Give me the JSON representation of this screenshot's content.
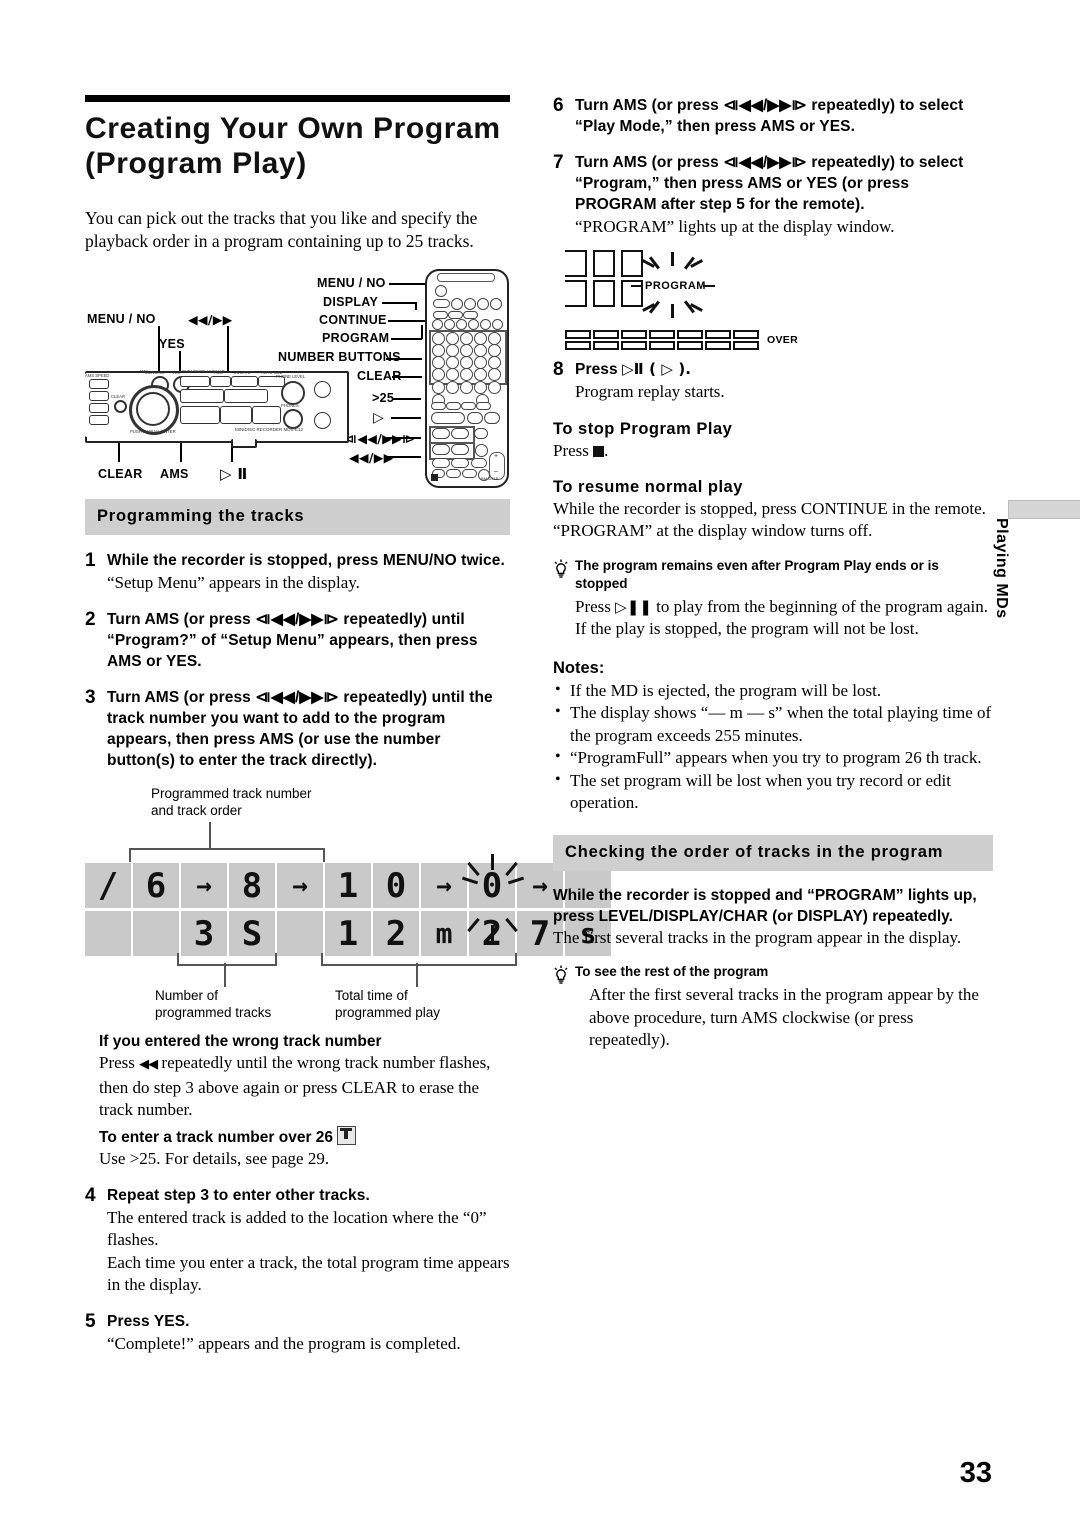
{
  "page": {
    "number": "33",
    "side_tab": "Playing MDs"
  },
  "left": {
    "title": "Creating Your Own Program (Program Play)",
    "title_line1": "Creating Your Own Program",
    "title_line2": "(Program Play)",
    "intro": "You can pick out the tracks that you like and specify the playback order in a program containing up to 25 tracks.",
    "section_heading": "Programming the tracks",
    "steps": [
      {
        "num": "1",
        "lead": "While the recorder is stopped, press MENU/NO twice.",
        "sub": "“Setup Menu” appears in the display."
      },
      {
        "num": "2",
        "lead": "Turn AMS (or press ⧏◀◀/▶▶⧐ repeatedly) until “Program?” of “Setup Menu” appears, then press AMS or YES.",
        "sub": ""
      },
      {
        "num": "3",
        "lead": "Turn AMS (or press ⧏◀◀/▶▶⧐ repeatedly) until the track number you want to add to the program appears, then press AMS (or use the number button(s) to enter the track directly).",
        "sub": ""
      }
    ],
    "wrong_track": {
      "heading": "If you entered the wrong track number",
      "body_pre": "Press ",
      "body_post": " repeatedly until the wrong track number flashes, then do step 3 above again or press CLEAR to erase the track number."
    },
    "over26": {
      "heading": "To enter a track number over 26",
      "body": "Use >25.  For details, see page 29."
    },
    "steps2": [
      {
        "num": "4",
        "lead": "Repeat step 3 to enter other tracks.",
        "sub1": "The entered track is added to the location where the “0” flashes.",
        "sub2": "Each time you enter a track, the total program time appears in the display."
      },
      {
        "num": "5",
        "lead": "Press YES.",
        "sub1": "“Complete!” appears and the program is completed."
      }
    ],
    "lcd": {
      "callout_top": "Programmed track number\nand track order",
      "callout_top_line1": "Programmed track number",
      "callout_top_line2": "and track order",
      "callout_left_line1": "Number of",
      "callout_left_line2": "programmed tracks",
      "callout_right_line1": "Total time of",
      "callout_right_line2": "programmed play",
      "row_top": [
        "/",
        "6",
        "→",
        "8",
        "→",
        "1",
        "0",
        "→",
        "0",
        "→",
        ""
      ],
      "row_bottom": [
        "",
        "",
        "3",
        "S",
        "",
        "1",
        "2",
        "m",
        "2",
        "7",
        "s"
      ]
    },
    "equipment_labels": {
      "deck_menu_no": "MENU / NO",
      "deck_ff_rew": "◀◀/▶▶",
      "deck_yes": "YES",
      "deck_clear": "CLEAR",
      "deck_ams": "AMS",
      "deck_play_pause": "▷ Ⅱ",
      "remote_menu_no": "MENU / NO",
      "remote_display": "DISPLAY",
      "remote_continue": "CONTINUE",
      "remote_program": "PROGRAM",
      "remote_number_buttons": "NUMBER BUTTONS",
      "remote_clear": "CLEAR",
      "remote_over25": ">25",
      "remote_play": "▷",
      "remote_skip": "⧏◀◀/▶▶⧐",
      "remote_scan": "◀◀/▶▶",
      "deck_model": "MINIDISC RECORDER MDS-E12",
      "deck_small_labels": [
        "MENU/NO",
        "AMS",
        "PUSH ENTER",
        "YES",
        "LEVEL / DISPLAY/CHAR",
        "TIME",
        "LOCATE",
        "AUTO CUE",
        "PHONE LEVEL",
        "PHONES",
        "MIN",
        "MAX",
        "CLEAR",
        "PUSH MANUAL/ENTER",
        "AMS SPEED"
      ]
    }
  },
  "right": {
    "steps": [
      {
        "num": "6",
        "lead": "Turn AMS (or press ⧏◀◀/▶▶⧐ repeatedly) to select “Play Mode,” then press AMS or YES.",
        "sub": ""
      },
      {
        "num": "7",
        "lead": "Turn AMS (or press ⧏◀◀/▶▶⧐ repeatedly) to select “Program,” then press AMS or YES (or press PROGRAM after step 5 for the remote).",
        "sub": "“PROGRAM” lights up at the display window."
      }
    ],
    "prog_display": {
      "word": "PROGRAM",
      "over": "OVER"
    },
    "step8": {
      "num": "8",
      "lead_pre": "Press ",
      "lead_symbols": "▷Ⅱ ( ▷ ).",
      "sub": "Program replay starts."
    },
    "stop_section": {
      "heading": "To stop Program Play",
      "body_pre": "Press ",
      "body_post": "."
    },
    "resume_section": {
      "heading": "To resume normal play",
      "body": "While the recorder is stopped, press CONTINUE in the remote. “PROGRAM” at the display window turns off."
    },
    "tip1": {
      "heading": "The program remains even after Program Play ends or is stopped",
      "body_pre": "Press ",
      "body_post": " to play from the beginning of the program again.  If the play is stopped, the program will not be lost."
    },
    "notes_heading": "Notes:",
    "notes": [
      "If the MD is ejected, the program will be lost.",
      "The display shows “— m — s” when the total playing time of the program exceeds 255 minutes.",
      "“ProgramFull” appears when you try to program 26 th track.",
      "The set program will be lost when you try record or edit operation."
    ],
    "section_heading": "Checking the order of tracks in the program",
    "check_lead": "While the recorder is stopped and “PROGRAM” lights up, press LEVEL/DISPLAY/CHAR (or DISPLAY) repeatedly.",
    "check_sub": "The first several tracks in the program appear in the display.",
    "tip2": {
      "heading": "To see the rest of the program",
      "body": "After the first several tracks in the program appear by the above procedure, turn AMS clockwise (or press repeatedly)."
    }
  },
  "colors": {
    "section_bar": "#cfcfcf",
    "lcd_cell": "#c9c9c9",
    "text": "#000000"
  }
}
